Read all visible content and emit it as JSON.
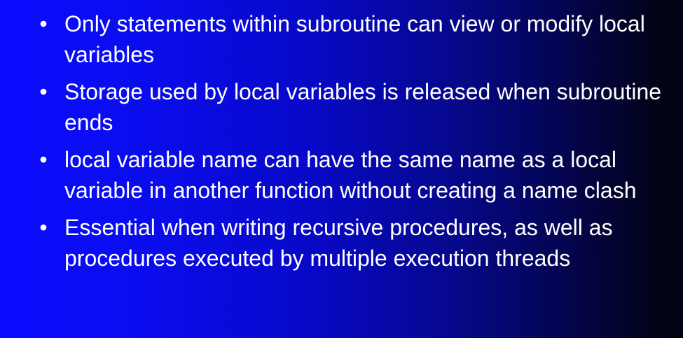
{
  "slide": {
    "bullet_marker": "•",
    "bullets": [
      {
        "text": "Only statements within subroutine can view or modify local variables"
      },
      {
        "text": "Storage used by local variables is released when subroutine ends"
      },
      {
        "text": "local variable name can have the same name as a local variable in another function without creating a name clash"
      },
      {
        "text": "Essential when writing recursive procedures, as well as procedures executed by multiple execution threads"
      }
    ]
  }
}
